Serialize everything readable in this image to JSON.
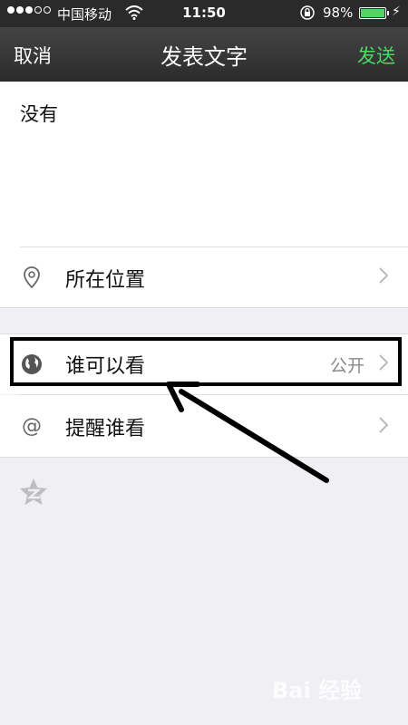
{
  "status_bar": {
    "carrier": "中国移动",
    "time": "11:50",
    "battery": "98%",
    "battery_level": 0.98
  },
  "nav": {
    "cancel": "取消",
    "title": "发表文字",
    "send": "发送",
    "send_color": "#4cd964"
  },
  "post": {
    "text": "没有"
  },
  "options": {
    "location": {
      "label": "所在位置",
      "icon": "location-pin-icon"
    },
    "visibility": {
      "label": "谁可以看",
      "value": "公开",
      "icon": "globe-icon"
    },
    "remind": {
      "label": "提醒谁看",
      "icon": "at-icon"
    }
  },
  "footer": {
    "share_icon": "qzone-star-icon"
  },
  "watermark": {
    "text": "Bai 经验"
  }
}
